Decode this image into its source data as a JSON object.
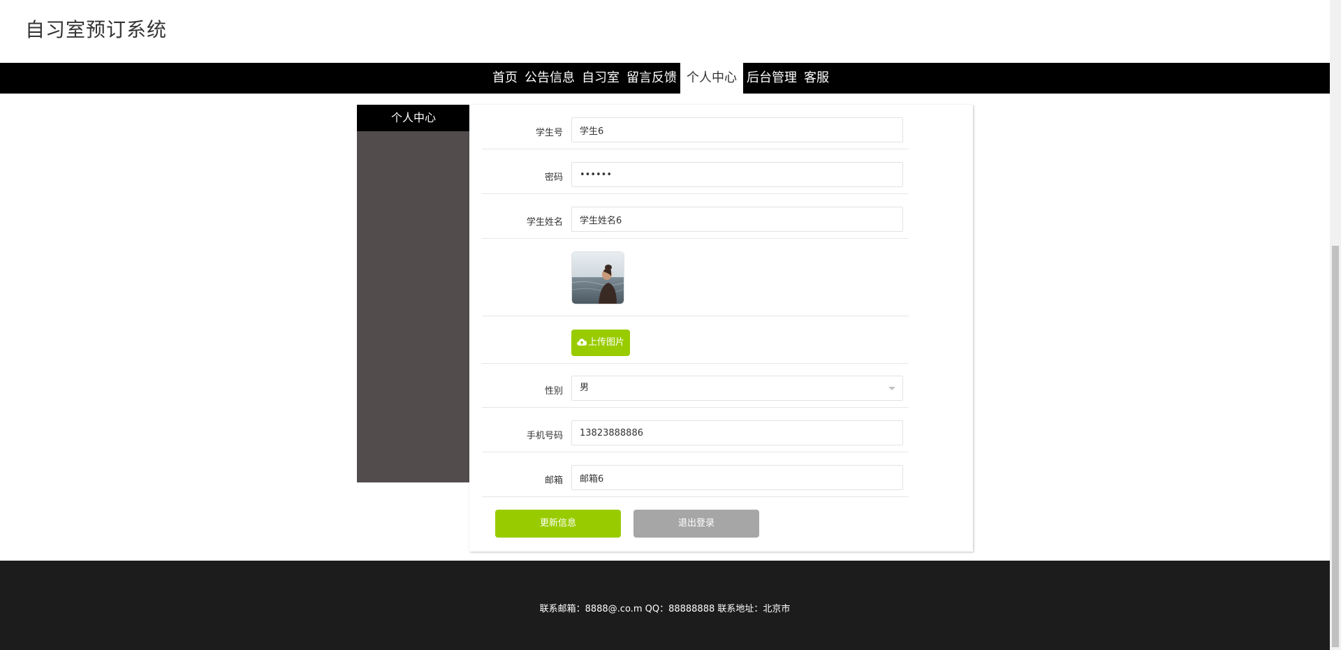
{
  "header": {
    "title": "自习室预订系统"
  },
  "nav": {
    "items": [
      {
        "label": "首页"
      },
      {
        "label": "公告信息"
      },
      {
        "label": "自习室"
      },
      {
        "label": "留言反馈"
      },
      {
        "label": "个人中心",
        "active": true
      },
      {
        "label": "后台管理"
      },
      {
        "label": "客服"
      }
    ]
  },
  "sidebar": {
    "title": "个人中心"
  },
  "form": {
    "student_no": {
      "label": "学生号",
      "value": "学生6"
    },
    "password": {
      "label": "密码",
      "value": "••••••"
    },
    "student_name": {
      "label": "学生姓名",
      "value": "学生姓名6"
    },
    "avatar": {
      "icon": "profile-photo"
    },
    "upload_label": "上传图片",
    "gender": {
      "label": "性别",
      "value": "男"
    },
    "phone": {
      "label": "手机号码",
      "value": "13823888886"
    },
    "email": {
      "label": "邮箱",
      "value": "邮箱6"
    },
    "update_button": "更新信息",
    "logout_button": "退出登录"
  },
  "footer": {
    "text": "联系邮箱：8888@.co.m QQ：88888888 联系地址：北京市"
  },
  "colors": {
    "accent": "#99cc00",
    "nav_bg": "#000000",
    "sidebar_bg": "#534c4c",
    "footer_bg": "#1c1c1c",
    "logout_bg": "#a6a6a6"
  }
}
